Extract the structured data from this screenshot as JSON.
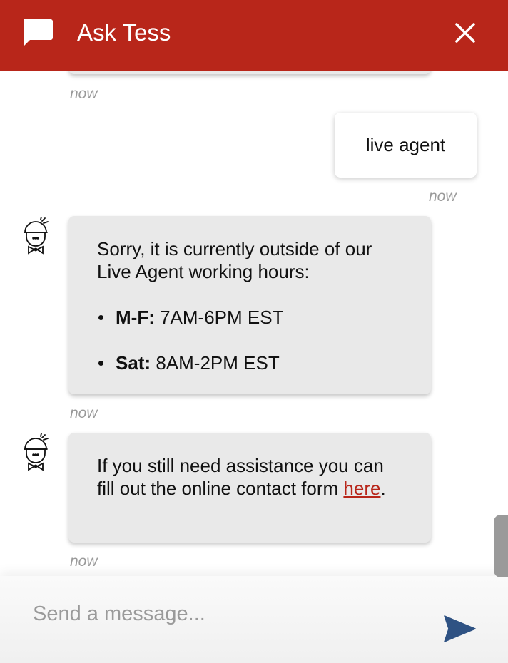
{
  "header": {
    "title": "Ask Tess",
    "bg_color": "#b8261a",
    "chat_icon": "chat-bubble-icon",
    "close_icon": "close-icon"
  },
  "messages": [
    {
      "sender": "bot",
      "timestamp": "now"
    },
    {
      "sender": "user",
      "text": "live agent",
      "timestamp": "now"
    },
    {
      "sender": "bot",
      "avatar": "grill-chef-icon",
      "intro": "Sorry, it is currently outside of our Live Agent working hours:",
      "hours": [
        {
          "label": "M-F:",
          "value": " 7AM-6PM EST"
        },
        {
          "label": "Sat:",
          "value": " 8AM-2PM EST"
        }
      ],
      "timestamp": "now"
    },
    {
      "sender": "bot",
      "avatar": "grill-chef-icon",
      "text_before": "If you still need assistance you can fill out the online contact form ",
      "link_text": "here",
      "text_after": ".",
      "timestamp": "now"
    }
  ],
  "composer": {
    "placeholder": "Send a message...",
    "value": "",
    "send_icon": "send-icon",
    "send_color": "#2f5283"
  },
  "link_color": "#b8261a"
}
